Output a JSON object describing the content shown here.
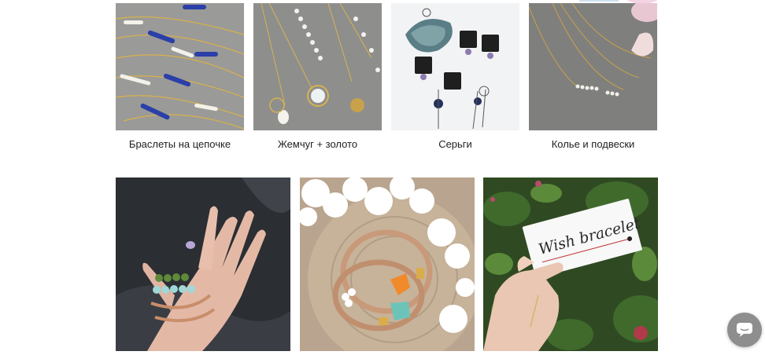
{
  "categories": [
    {
      "label": "Браслеты на цепочке",
      "icon": "bracelets-chain-photo"
    },
    {
      "label": "Жемчуг + золото",
      "icon": "pearl-gold-photo"
    },
    {
      "label": "Серьги",
      "icon": "earrings-photo"
    },
    {
      "label": "Колье и подвески",
      "icon": "necklaces-photo"
    }
  ],
  "gallery": [
    {
      "icon": "hand-bracelets-photo"
    },
    {
      "icon": "leather-bracelets-photo"
    },
    {
      "icon": "wish-bracelet-card-photo",
      "card_text": "Wish bracelet"
    }
  ],
  "chat": {
    "icon": "chat-bubble-icon"
  },
  "colors": {
    "accent_chat": "#8e8e8e",
    "caption_text": "#222222"
  }
}
